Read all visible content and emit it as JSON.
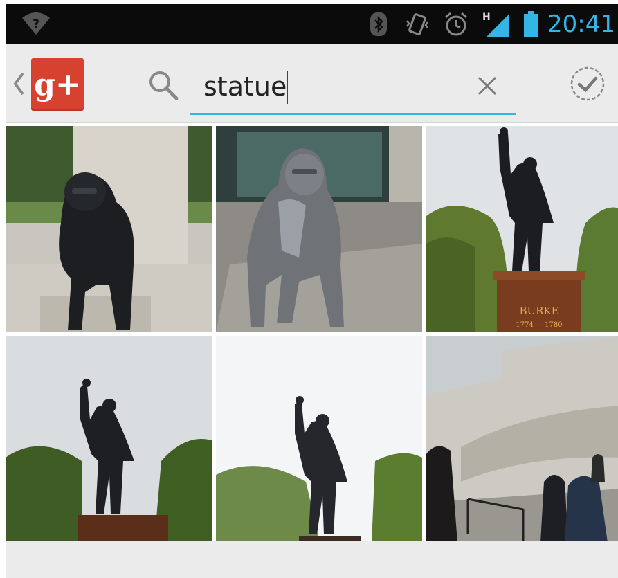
{
  "status_bar": {
    "time": "20:41",
    "icons": [
      "wifi-question-icon",
      "bluetooth-icon",
      "vibrate-icon",
      "alarm-icon",
      "signal-h-icon",
      "battery-icon"
    ],
    "network_type": "H",
    "accent": "#33b5e5"
  },
  "action_bar": {
    "app_icon": "google-plus-icon",
    "app_icon_text": "g+",
    "search": {
      "value": "statue",
      "placeholder": ""
    },
    "colors": {
      "app_icon_bg": "#d6422f",
      "underline": "#33b5e5",
      "background": "#ebebeb"
    }
  },
  "results": {
    "photos": [
      {
        "subject": "gorilla-statue-dark-icon"
      },
      {
        "subject": "gorilla-statue-silver-icon"
      },
      {
        "subject": "burke-statue-icon",
        "plinth_text": "BURKE",
        "plinth_years": "1774 — 1780"
      },
      {
        "subject": "burke-statue-icon"
      },
      {
        "subject": "burke-statue-icon"
      },
      {
        "subject": "memorial-frieze-icon"
      }
    ]
  }
}
